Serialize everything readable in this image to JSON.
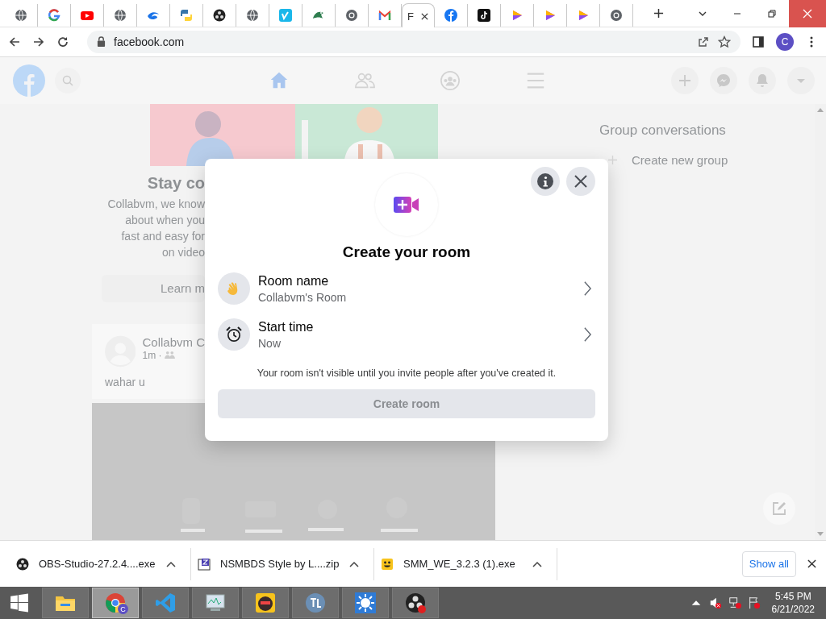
{
  "browser": {
    "tabs": [
      {
        "kind": "globe",
        "selected": false
      },
      {
        "kind": "google",
        "selected": false
      },
      {
        "kind": "youtube",
        "selected": false
      },
      {
        "kind": "globe",
        "selected": false
      },
      {
        "kind": "swirl",
        "selected": false
      },
      {
        "kind": "python",
        "selected": false
      },
      {
        "kind": "obs",
        "selected": false
      },
      {
        "kind": "globe",
        "selected": false
      },
      {
        "kind": "vimeo",
        "selected": false
      },
      {
        "kind": "bird",
        "selected": false
      },
      {
        "kind": "chrome",
        "selected": false
      },
      {
        "kind": "gmail",
        "selected": false
      },
      {
        "kind": "text",
        "title": "F",
        "selected": true
      },
      {
        "kind": "facebook",
        "selected": false
      },
      {
        "kind": "tiktok",
        "selected": false
      },
      {
        "kind": "play",
        "selected": false
      },
      {
        "kind": "play",
        "selected": false
      },
      {
        "kind": "play",
        "selected": false
      },
      {
        "kind": "chrome",
        "selected": false
      }
    ],
    "address": "facebook.com",
    "profile": "C"
  },
  "page": {
    "feed": {
      "card_title": "Stay co",
      "card_lines": [
        "Collabvm, we know",
        "about when you",
        "fast and easy for",
        "on video"
      ],
      "card_button": "Learn m",
      "post_author": "Collabvm C",
      "post_time": "1m ·",
      "post_text": "wahar u"
    },
    "sidebar": {
      "heading": "Group conversations",
      "action": "Create new group"
    }
  },
  "dialog": {
    "title": "Create your room",
    "rows": [
      {
        "kind": "wave",
        "label": "Room name",
        "value": "Collabvm's Room"
      },
      {
        "kind": "clock",
        "label": "Start time",
        "value": "Now"
      }
    ],
    "note": "Your room isn't visible until you invite people after you've created it.",
    "button": {
      "label": "Create room",
      "disabled": true
    }
  },
  "downloads": {
    "items": [
      {
        "kind": "obs",
        "name": "OBS-Studio-27.2.4....exe"
      },
      {
        "kind": "archive",
        "name": "NSMBDS Style by L....zip"
      },
      {
        "kind": "smiley",
        "name": "SMM_WE_3.2.3 (1).exe"
      }
    ],
    "show_all": "Show all"
  },
  "taskbar": {
    "apps": [
      {
        "kind": "explorer",
        "selected": false
      },
      {
        "kind": "chrome",
        "selected": true,
        "badge": "C"
      },
      {
        "kind": "vscode",
        "selected": false
      },
      {
        "kind": "monitor",
        "selected": false
      },
      {
        "kind": "face",
        "selected": false
      },
      {
        "kind": "tl",
        "selected": false
      },
      {
        "kind": "sun",
        "selected": false
      },
      {
        "kind": "obs",
        "selected": false
      }
    ],
    "time": "5:45 PM",
    "date": "6/21/2022"
  }
}
